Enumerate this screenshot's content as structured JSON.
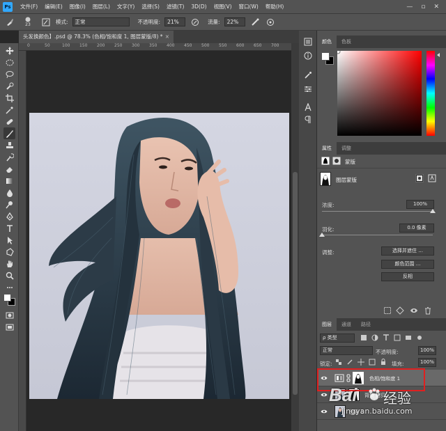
{
  "menu": {
    "logo": "Ps",
    "items": [
      "文件(F)",
      "编辑(E)",
      "图像(I)",
      "图层(L)",
      "文字(Y)",
      "选择(S)",
      "滤镜(T)",
      "3D(D)",
      "视图(V)",
      "窗口(W)",
      "帮助(H)"
    ],
    "window_controls": [
      "—",
      "▫",
      "✕"
    ]
  },
  "options": {
    "brush_size": "23",
    "mode_label": "模式:",
    "mode_value": "正常",
    "opacity_label": "不透明度:",
    "opacity_value": "21%",
    "flow_label": "流量:",
    "flow_value": "22%"
  },
  "document": {
    "tab_title": "头发换颜色】.psd @ 78.3% (色相/饱和度 1, 图层蒙版/8) *",
    "close": "×",
    "ruler_marks": [
      "0",
      "50",
      "100",
      "150",
      "200",
      "250",
      "300",
      "350",
      "400",
      "450",
      "500",
      "550",
      "600",
      "650",
      "700"
    ]
  },
  "color_panel": {
    "tabs": [
      "颜色",
      "色板"
    ],
    "hue_color": "#ff0000"
  },
  "properties_panel": {
    "tabs": [
      "属性",
      "调整"
    ],
    "mask_label": "蒙版",
    "layer_mask_title": "图层蒙版",
    "density_label": "浓度:",
    "density_value": "100%",
    "density_fraction": 1.0,
    "feather_label": "羽化:",
    "feather_value": "0.0 像素",
    "feather_fraction": 0.0,
    "refine_label": "调整:",
    "buttons": [
      "选择并遮住 ...",
      "颜色范围 ...",
      "反相"
    ]
  },
  "layers_panel": {
    "tabs": [
      "图层",
      "通道",
      "路径"
    ],
    "filter_label": "ρ 类型",
    "blend_mode": "正常",
    "opacity_label": "不透明度:",
    "opacity_value": "100%",
    "lock_label": "锁定:",
    "fill_label": "填充:",
    "fill_value": "100%",
    "layers": [
      {
        "name": "色相/饱和度 1",
        "selected": true
      },
      {
        "name": "背景 拷贝",
        "selected": false
      },
      {
        "name": "图层 1",
        "selected": false
      }
    ],
    "highlight_color": "#e02020"
  },
  "watermark": {
    "brand": "Bai",
    "suffix": "经验",
    "url": "jingyan.baidu.com"
  }
}
